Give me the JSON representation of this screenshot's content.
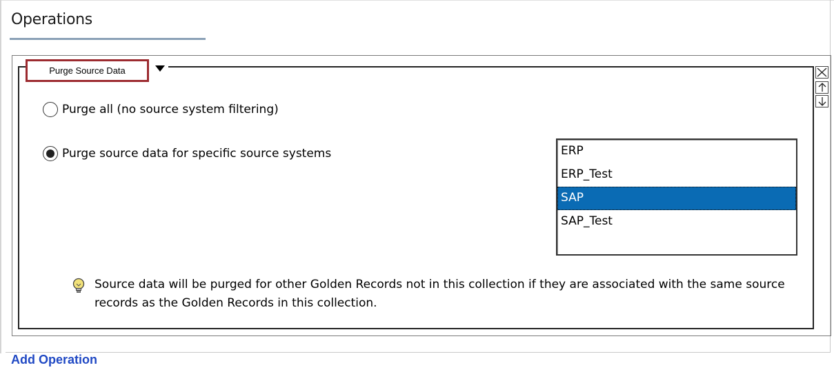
{
  "section": {
    "title": "Operations"
  },
  "operation": {
    "type_label": "Purge Source Data",
    "controls": {
      "remove_icon": "close-icon",
      "up_icon": "arrow-up-icon",
      "down_icon": "arrow-down-icon"
    },
    "options": [
      {
        "label": "Purge all (no source system filtering)",
        "selected": false
      },
      {
        "label": "Purge source data for specific source systems",
        "selected": true
      }
    ],
    "source_systems": [
      {
        "label": "ERP",
        "selected": false
      },
      {
        "label": "ERP_Test",
        "selected": false
      },
      {
        "label": "SAP",
        "selected": true
      },
      {
        "label": "SAP_Test",
        "selected": false
      }
    ],
    "hint": {
      "icon": "lightbulb-icon",
      "text": "Source data will be purged for other Golden Records not in this collection if they are associated with the same source records as the Golden Records in this collection."
    }
  },
  "footer": {
    "add_operation": "Add Operation"
  },
  "colors": {
    "highlight_border": "#9c2a2f",
    "selection": "#0a6bb4",
    "link": "#2049c4"
  }
}
